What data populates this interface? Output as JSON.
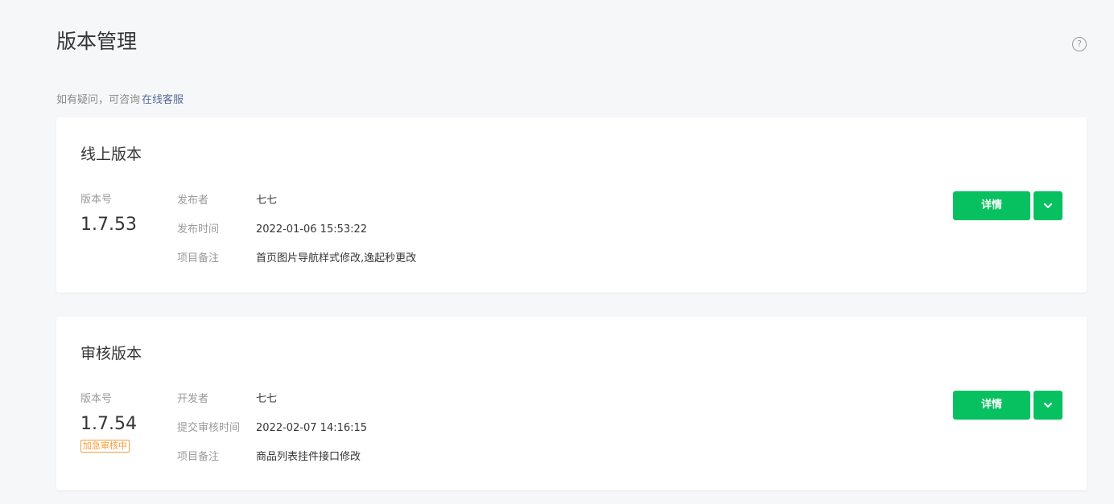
{
  "page": {
    "title": "版本管理",
    "hint_text": "如有疑问，可咨询",
    "hint_link": "在线客服",
    "help_icon_glyph": "?"
  },
  "online": {
    "title": "线上版本",
    "version_label": "版本号",
    "version": "1.7.53",
    "rows": [
      {
        "key": "发布者",
        "value": "七七"
      },
      {
        "key": "发布时间",
        "value": "2022-01-06 15:53:22"
      },
      {
        "key": "项目备注",
        "value": "首页图片导航样式修改,逸起秒更改"
      }
    ],
    "detail_label": "详情"
  },
  "review": {
    "title": "审核版本",
    "version_label": "版本号",
    "version": "1.7.54",
    "tag": "加急审核中",
    "rows": [
      {
        "key": "开发者",
        "value": "七七"
      },
      {
        "key": "提交审核时间",
        "value": "2022-02-07 14:16:15"
      },
      {
        "key": "项目备注",
        "value": "商品列表挂件接口修改"
      }
    ],
    "detail_label": "详情"
  },
  "colors": {
    "brand_green": "#07c160",
    "link": "#576b95",
    "urgent_orange": "#fa9d3b"
  }
}
